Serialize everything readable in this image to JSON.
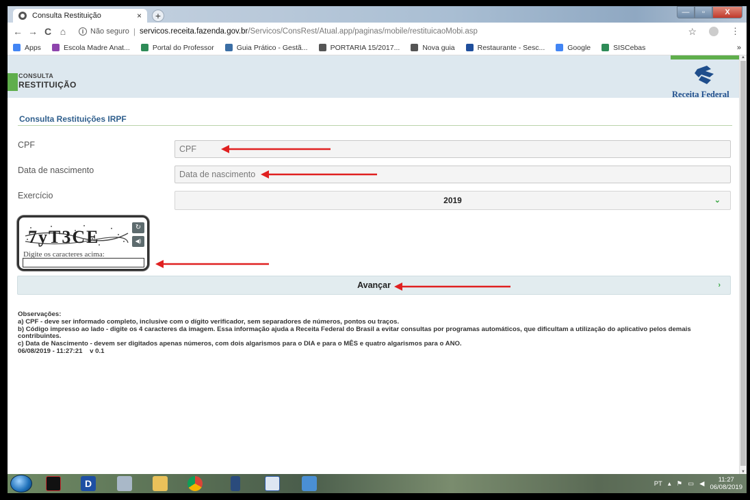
{
  "browser": {
    "tab_title": "Consulta Restituição",
    "tab_close": "×",
    "new_tab": "+",
    "window_controls": {
      "minimize": "—",
      "maximize": "▫",
      "close": "X"
    },
    "nav": {
      "back": "←",
      "forward": "→",
      "reload": "C",
      "home": "⌂"
    },
    "security_label": "Não seguro",
    "url_host": "servicos.receita.fazenda.gov.br",
    "url_path": "/Servicos/ConsRest/Atual.app/paginas/mobile/restituicaoMobi.asp",
    "bookmarks": [
      {
        "label": "Apps",
        "icon": "apps-grid-icon",
        "color": "#4285f4"
      },
      {
        "label": "Escola Madre Anat...",
        "icon": "escola-icon",
        "color": "#8e44ad"
      },
      {
        "label": "Portal do Professor",
        "icon": "portal-icon",
        "color": "#2e8b57"
      },
      {
        "label": "Guia Prático - Gestã...",
        "icon": "guia-icon",
        "color": "#3b6ea5"
      },
      {
        "label": "PORTARIA 15/2017...",
        "icon": "globe-icon",
        "color": "#555555"
      },
      {
        "label": "Nova guia",
        "icon": "globe-icon",
        "color": "#555555"
      },
      {
        "label": "Restaurante - Sesc...",
        "icon": "sesc-icon",
        "color": "#1f4e9c"
      },
      {
        "label": "Google",
        "icon": "google-icon",
        "color": "#4285f4"
      },
      {
        "label": "SISCebas",
        "icon": "siscebas-icon",
        "color": "#2e8b57"
      }
    ],
    "bookmarks_more": "»"
  },
  "header": {
    "small_title": "CONSULTA",
    "big_title": "RESTITUIÇÃO",
    "logo_text": "Receita Federal",
    "accent_green": "#5fae4c"
  },
  "form": {
    "section_title": "Consulta Restituições IRPF",
    "cpf": {
      "label": "CPF",
      "placeholder": "CPF"
    },
    "birth": {
      "label": "Data de nascimento",
      "placeholder": "Data de nascimento"
    },
    "exercise": {
      "label": "Exercício",
      "value": "2019",
      "chevron": "⌄"
    },
    "captcha": {
      "text": "7yT3CE",
      "label": "Digite os caracteres acima:",
      "refresh": "↻",
      "audio": "◀)"
    },
    "advance_label": "Avançar",
    "advance_chevron": "›"
  },
  "observations": {
    "title": "Observações:",
    "lines": [
      "a) CPF - deve ser informado completo, inclusive com o dígito verificador, sem separadores de números, pontos ou traços.",
      "b) Código impresso ao lado - digite os 4 caracteres da imagem. Essa informação ajuda a Receita Federal do Brasil a evitar consultas por programas automáticos, que dificultam a utilização do aplicativo pelos demais contribuintes.",
      "c) Data de Nascimento - devem ser digitados apenas números, com dois algarismos para o DIA e para o MÊS e quatro algarismos para o ANO."
    ],
    "timestamp": "06/08/2019 - 11:27:21",
    "version": "v 0.1"
  },
  "annotation_color": "#e02020",
  "taskbar": {
    "language": "PT",
    "time": "11:27",
    "date": "06/08/2019"
  }
}
